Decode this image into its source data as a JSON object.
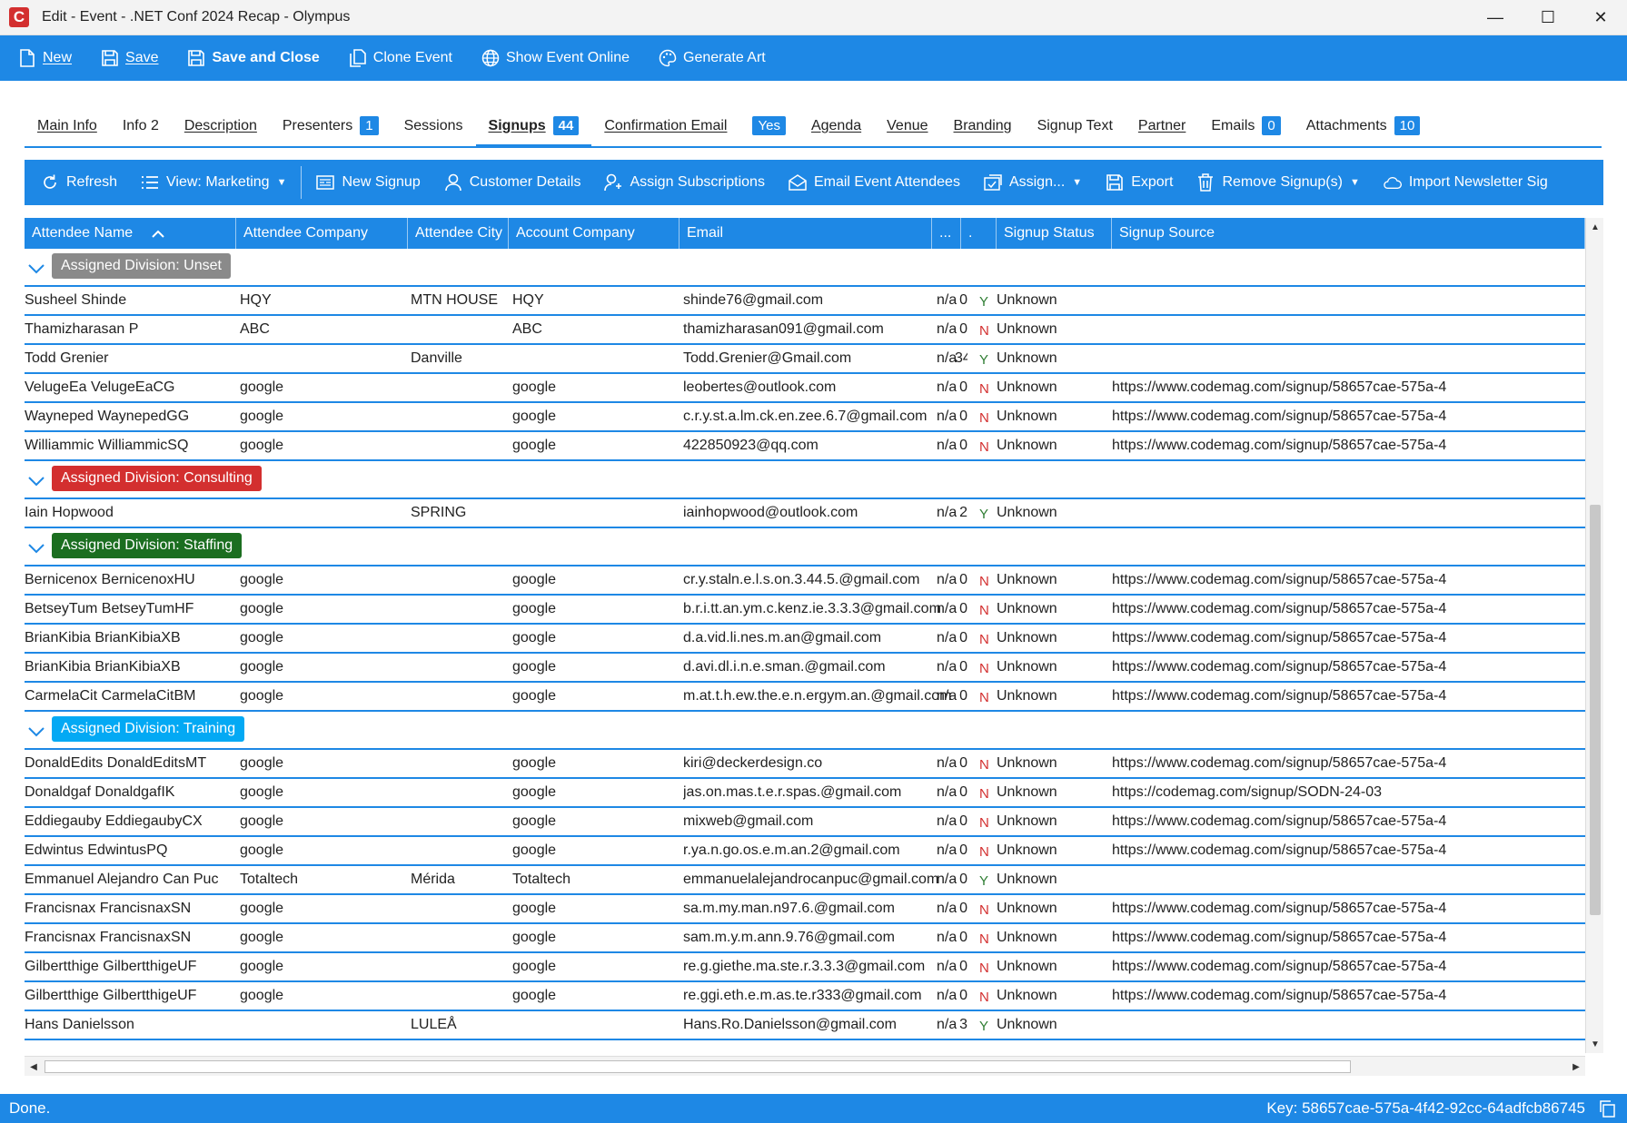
{
  "window": {
    "title": "Edit - Event - .NET Conf 2024 Recap - Olympus",
    "app_icon_letter": "C",
    "minimize": "—",
    "maximize": "☐",
    "close": "✕"
  },
  "toolbar": {
    "new_label": "New",
    "save_label": "Save",
    "save_close_label": "Save and Close",
    "clone_label": "Clone Event",
    "show_online_label": "Show Event Online",
    "generate_art_label": "Generate Art"
  },
  "tabs": [
    {
      "label": "Main Info",
      "badge": null
    },
    {
      "label": "Info 2",
      "badge": null
    },
    {
      "label": "Description",
      "badge": null
    },
    {
      "label": "Presenters",
      "badge": "1"
    },
    {
      "label": "Sessions",
      "badge": null
    },
    {
      "label": "Signups",
      "badge": "44"
    },
    {
      "label": "Confirmation Email",
      "badge": "Yes"
    },
    {
      "label": "Agenda",
      "badge": null
    },
    {
      "label": "Venue",
      "badge": null
    },
    {
      "label": "Branding",
      "badge": null
    },
    {
      "label": "Signup Text",
      "badge": null
    },
    {
      "label": "Partner",
      "badge": null
    },
    {
      "label": "Emails",
      "badge": "0"
    },
    {
      "label": "Attachments",
      "badge": "10"
    }
  ],
  "gridbar": {
    "refresh_label": "Refresh",
    "view_label": "View: Marketing",
    "new_signup_label": "New Signup",
    "customer_details_label": "Customer Details",
    "assign_subscriptions_label": "Assign Subscriptions",
    "email_attendees_label": "Email Event Attendees",
    "assign_label": "Assign...",
    "export_label": "Export",
    "remove_label": "Remove Signup(s)",
    "import_label": "Import Newsletter Sig"
  },
  "grid": {
    "columns": [
      "Attendee Name",
      "Attendee Company",
      "Attendee City",
      "Account Company",
      "Email",
      "...",
      ".",
      "Signup Status",
      "Signup Source"
    ],
    "groups": [
      {
        "label": "Assigned Division: Unset",
        "color": "#8a8a8a",
        "rows": [
          [
            "Susheel Shinde",
            "HQY",
            "MTN HOUSE",
            "HQY",
            "shinde76@gmail.com",
            "n/a",
            "0",
            "Y",
            "Unknown",
            ""
          ],
          [
            "Thamizharasan P",
            "ABC",
            "",
            "ABC",
            "thamizharasan091@gmail.com",
            "n/a",
            "0",
            "N",
            "Unknown",
            ""
          ],
          [
            "Todd Grenier",
            "",
            "Danville",
            "",
            "Todd.Grenier@Gmail.com",
            "n/a",
            "34",
            "Y",
            "Unknown",
            ""
          ],
          [
            "VelugeEa VelugeEaCG",
            "google",
            "",
            "google",
            "leobertes@outlook.com",
            "n/a",
            "0",
            "N",
            "Unknown",
            "https://www.codemag.com/signup/58657cae-575a-4"
          ],
          [
            "Wayneped WaynepedGG",
            "google",
            "",
            "google",
            "c.r.y.st.a.lm.ck.en.zee.6.7@gmail.com",
            "n/a",
            "0",
            "N",
            "Unknown",
            "https://www.codemag.com/signup/58657cae-575a-4"
          ],
          [
            "Williammic WilliammicSQ",
            "google",
            "",
            "google",
            "422850923@qq.com",
            "n/a",
            "0",
            "N",
            "Unknown",
            "https://www.codemag.com/signup/58657cae-575a-4"
          ]
        ]
      },
      {
        "label": "Assigned Division: Consulting",
        "color": "#d32f2f",
        "rows": [
          [
            "Iain Hopwood",
            "",
            "SPRING",
            "",
            "iainhopwood@outlook.com",
            "n/a",
            "2",
            "Y",
            "Unknown",
            ""
          ]
        ]
      },
      {
        "label": "Assigned Division: Staffing",
        "color": "#1b6e20",
        "rows": [
          [
            "Bernicenox BernicenoxHU",
            "google",
            "",
            "google",
            "cr.y.staln.e.l.s.on.3.44.5.@gmail.com",
            "n/a",
            "0",
            "N",
            "Unknown",
            "https://www.codemag.com/signup/58657cae-575a-4"
          ],
          [
            "BetseyTum BetseyTumHF",
            "google",
            "",
            "google",
            "b.r.i.tt.an.ym.c.kenz.ie.3.3.3@gmail.com",
            "n/a",
            "0",
            "N",
            "Unknown",
            "https://www.codemag.com/signup/58657cae-575a-4"
          ],
          [
            "BrianKibia BrianKibiaXB",
            "google",
            "",
            "google",
            "d.a.vid.li.nes.m.an@gmail.com",
            "n/a",
            "0",
            "N",
            "Unknown",
            "https://www.codemag.com/signup/58657cae-575a-4"
          ],
          [
            "BrianKibia BrianKibiaXB",
            "google",
            "",
            "google",
            "d.avi.dl.i.n.e.sman.@gmail.com",
            "n/a",
            "0",
            "N",
            "Unknown",
            "https://www.codemag.com/signup/58657cae-575a-4"
          ],
          [
            "CarmelaCit CarmelaCitBM",
            "google",
            "",
            "google",
            "m.at.t.h.ew.the.e.n.ergym.an.@gmail.com",
            "n/a",
            "0",
            "N",
            "Unknown",
            "https://www.codemag.com/signup/58657cae-575a-4"
          ]
        ]
      },
      {
        "label": "Assigned Division: Training",
        "color": "#03a9f4",
        "rows": [
          [
            "DonaldEdits DonaldEditsMT",
            "google",
            "",
            "google",
            "kiri@deckerdesign.co",
            "n/a",
            "0",
            "N",
            "Unknown",
            "https://www.codemag.com/signup/58657cae-575a-4"
          ],
          [
            "Donaldgaf DonaldgafIK",
            "google",
            "",
            "google",
            "jas.on.mas.t.e.r.spas.@gmail.com",
            "n/a",
            "0",
            "N",
            "Unknown",
            "https://codemag.com/signup/SODN-24-03"
          ],
          [
            "Eddiegauby EddiegaubyCX",
            "google",
            "",
            "google",
            "mixweb@gmail.com",
            "n/a",
            "0",
            "N",
            "Unknown",
            "https://www.codemag.com/signup/58657cae-575a-4"
          ],
          [
            "Edwintus EdwintusPQ",
            "google",
            "",
            "google",
            "r.ya.n.go.os.e.m.an.2@gmail.com",
            "n/a",
            "0",
            "N",
            "Unknown",
            "https://www.codemag.com/signup/58657cae-575a-4"
          ],
          [
            "Emmanuel Alejandro Can Puc",
            "Totaltech",
            "Mérida",
            "Totaltech",
            "emmanuelalejandrocanpuc@gmail.com",
            "n/a",
            "0",
            "Y",
            "Unknown",
            ""
          ],
          [
            "Francisnax FrancisnaxSN",
            "google",
            "",
            "google",
            "sa.m.my.man.n97.6.@gmail.com",
            "n/a",
            "0",
            "N",
            "Unknown",
            "https://www.codemag.com/signup/58657cae-575a-4"
          ],
          [
            "Francisnax FrancisnaxSN",
            "google",
            "",
            "google",
            "sam.m.y.m.ann.9.76@gmail.com",
            "n/a",
            "0",
            "N",
            "Unknown",
            "https://www.codemag.com/signup/58657cae-575a-4"
          ],
          [
            "Gilbertthige GilbertthigeUF",
            "google",
            "",
            "google",
            "re.g.giethe.ma.ste.r.3.3.3@gmail.com",
            "n/a",
            "0",
            "N",
            "Unknown",
            "https://www.codemag.com/signup/58657cae-575a-4"
          ],
          [
            "Gilbertthige GilbertthigeUF",
            "google",
            "",
            "google",
            "re.ggi.eth.e.m.as.te.r333@gmail.com",
            "n/a",
            "0",
            "N",
            "Unknown",
            "https://www.codemag.com/signup/58657cae-575a-4"
          ],
          [
            "Hans Danielsson",
            "",
            "LULEÅ",
            "",
            "Hans.Ro.Danielsson@gmail.com",
            "n/a",
            "3",
            "Y",
            "Unknown",
            ""
          ]
        ]
      }
    ]
  },
  "status": {
    "left": "Done.",
    "right": "Key: 58657cae-575a-4f42-92cc-64adfcb86745"
  }
}
